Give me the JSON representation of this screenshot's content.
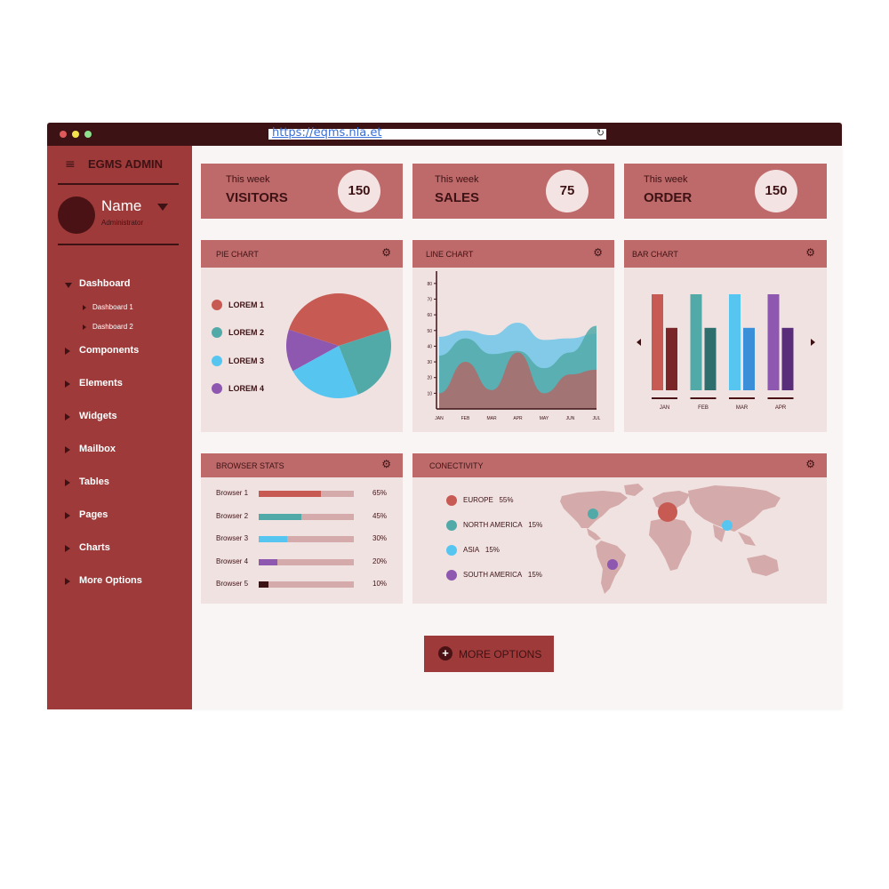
{
  "browser": {
    "url": "https://eqms.nla.et",
    "reload_icon": "reload-icon",
    "dots": [
      "#e05a5a",
      "#f3e24c",
      "#8ee08e"
    ]
  },
  "sidebar": {
    "brand": "EGMS ADMIN",
    "menu_icon": "hamburger-icon",
    "user": {
      "name": "Name",
      "role": "Administrator"
    },
    "items": [
      {
        "label": "Dashboard",
        "expanded": true,
        "children": [
          "Dashboard 1",
          "Dashboard 2"
        ]
      },
      {
        "label": "Components"
      },
      {
        "label": "Elements"
      },
      {
        "label": "Widgets"
      },
      {
        "label": "Mailbox"
      },
      {
        "label": "Tables"
      },
      {
        "label": "Pages"
      },
      {
        "label": "Charts"
      },
      {
        "label": "More Options"
      }
    ]
  },
  "stats": [
    {
      "caption": "This week",
      "label": "VISITORS",
      "value": "150"
    },
    {
      "caption": "This week",
      "label": "SALES",
      "value": "75"
    },
    {
      "caption": "This week",
      "label": "ORDER",
      "value": "150"
    }
  ],
  "colors": {
    "c1": "#c75b53",
    "c2": "#52aaa8",
    "c3": "#56c6f1",
    "c4": "#8e57b0"
  },
  "pie_card": {
    "title": "PIE CHART",
    "settings_icon": "gear-icon"
  },
  "line_card": {
    "title": "LINE CHART",
    "settings_icon": "gear-icon"
  },
  "bar_card": {
    "title": "BAR CHART",
    "settings_icon": "gear-icon",
    "prev_icon": "arrow-left-icon",
    "next_icon": "arrow-right-icon"
  },
  "browser_card": {
    "title": "BROWSER STATS",
    "settings_icon": "gear-icon"
  },
  "conn_card": {
    "title": "CONECTIVITY",
    "settings_icon": "gear-icon",
    "map_icon": "world-map"
  },
  "more_button": {
    "label": "MORE OPTIONS",
    "icon": "plus-icon"
  },
  "chart_data": [
    {
      "type": "pie",
      "title": "PIE CHART",
      "labels": [
        "LOREM 1",
        "LOREM 2",
        "LOREM 3",
        "LOREM 4"
      ],
      "values": [
        40,
        24,
        23,
        13
      ],
      "colors": [
        "#c75b53",
        "#52aaa8",
        "#56c6f1",
        "#8e57b0"
      ],
      "legend": "left"
    },
    {
      "type": "area",
      "title": "LINE CHART",
      "x": [
        "JAN",
        "FEB",
        "MAR",
        "APR",
        "MAY",
        "JUN",
        "JUL"
      ],
      "y_ticks": [
        10,
        20,
        30,
        40,
        50,
        60,
        70,
        80
      ],
      "ylim": [
        0,
        85
      ],
      "series": [
        {
          "values": [
            46,
            50,
            47,
            55,
            44,
            45,
            48
          ],
          "color": "#6fc6e8"
        },
        {
          "values": [
            34,
            45,
            35,
            37,
            26,
            36,
            53
          ],
          "color": "#52aaa8"
        },
        {
          "values": [
            10,
            30,
            12,
            36,
            10,
            22,
            25
          ],
          "color": "#b06a68"
        }
      ]
    },
    {
      "type": "bar",
      "title": "BAR CHART",
      "categories": [
        "JAN",
        "FEB",
        "MAR",
        "APR"
      ],
      "series": [
        {
          "values": [
            100,
            100,
            100,
            100
          ],
          "colors": [
            "#c75b53",
            "#52aaa8",
            "#56c6f1",
            "#8e57b0"
          ]
        },
        {
          "values": [
            65,
            65,
            65,
            65
          ],
          "colors": [
            "#7a2528",
            "#2e6f6d",
            "#3a8fd8",
            "#5a2d7a"
          ]
        }
      ]
    },
    {
      "type": "bar",
      "title": "BROWSER STATS",
      "orientation": "horizontal",
      "categories": [
        "Browser 1",
        "Browser 2",
        "Browser 3",
        "Browser 4",
        "Browser 5"
      ],
      "values": [
        65,
        45,
        30,
        20,
        10
      ],
      "labels": [
        "65%",
        "45%",
        "30%",
        "20%",
        "10%"
      ],
      "colors": [
        "#c75b53",
        "#52aaa8",
        "#56c6f1",
        "#8e57b0",
        "#3d1214"
      ],
      "xlim": [
        0,
        100
      ]
    }
  ],
  "connectivity": [
    {
      "label": "EUROPE",
      "value": "55%",
      "color": "#c75b53"
    },
    {
      "label": "NORTH AMERICA",
      "value": "15%",
      "color": "#52aaa8"
    },
    {
      "label": "ASIA",
      "value": "15%",
      "color": "#56c6f1"
    },
    {
      "label": "SOUTH AMERICA",
      "value": "15%",
      "color": "#8e57b0"
    }
  ]
}
